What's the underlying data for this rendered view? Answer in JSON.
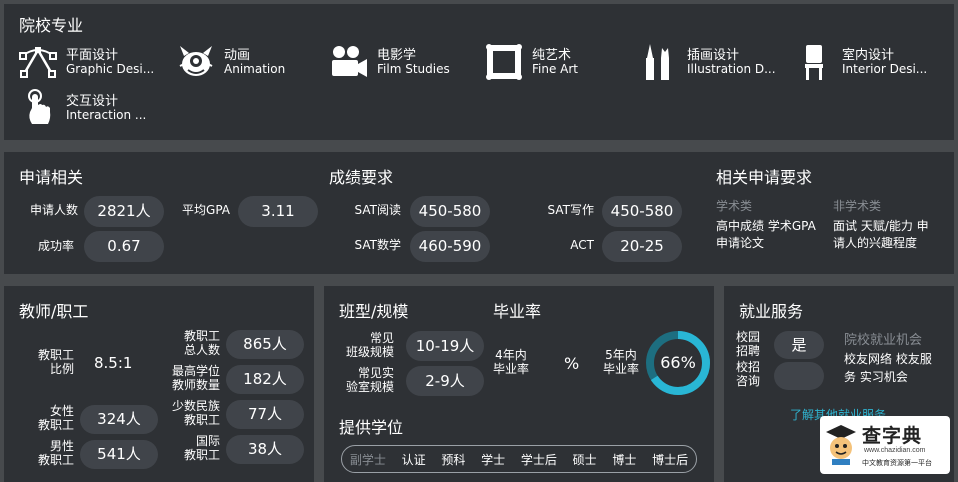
{
  "majors": {
    "title": "院校专业",
    "items": [
      {
        "zh": "平面设计",
        "en": "Graphic Desi...",
        "icon": "pen-tool-icon"
      },
      {
        "zh": "动画",
        "en": "Animation",
        "icon": "creature-icon"
      },
      {
        "zh": "电影学",
        "en": "Film Studies",
        "icon": "film-camera-icon"
      },
      {
        "zh": "纯艺术",
        "en": "Fine Art",
        "icon": "picture-frame-icon"
      },
      {
        "zh": "插画设计",
        "en": "Illustration D...",
        "icon": "brushes-icon"
      },
      {
        "zh": "室内设计",
        "en": "Interior Desi...",
        "icon": "chair-icon"
      },
      {
        "zh": "交互设计",
        "en": "Interaction ...",
        "icon": "touch-hand-icon"
      }
    ]
  },
  "application": {
    "title": "申请相关",
    "applicants_label": "申请人数",
    "applicants_value": "2821人",
    "gpa_label": "平均GPA",
    "gpa_value": "3.11",
    "success_label": "成功率",
    "success_value": "0.67"
  },
  "scores": {
    "title": "成绩要求",
    "sat_reading_label": "SAT阅读",
    "sat_reading_value": "450-580",
    "sat_writing_label": "SAT写作",
    "sat_writing_value": "450-580",
    "sat_math_label": "SAT数学",
    "sat_math_value": "460-590",
    "act_label": "ACT",
    "act_value": "20-25"
  },
  "requirements": {
    "title": "相关申请要求",
    "academic_title": "学术类",
    "academic_line1": "高中成绩 学术GPA",
    "academic_line2": "申请论文",
    "nonacademic_title": "非学术类",
    "nonacademic_line1": "面试 天赋/能力 申",
    "nonacademic_line2": "请人的兴趣程度"
  },
  "faculty": {
    "title": "教师/职工",
    "ratio_label_1": "教职工",
    "ratio_label_2": "比例",
    "ratio_value": "8.5:1",
    "total_label_1": "教职工",
    "total_label_2": "总人数",
    "total_value": "865人",
    "highest_label_1": "最高学位",
    "highest_label_2": "教师数量",
    "highest_value": "182人",
    "female_label_1": "女性",
    "female_label_2": "教职工",
    "female_value": "324人",
    "minority_label_1": "少数民族",
    "minority_label_2": "教职工",
    "minority_value": "77人",
    "male_label_1": "男性",
    "male_label_2": "教职工",
    "male_value": "541人",
    "intl_label_1": "国际",
    "intl_label_2": "教职工",
    "intl_value": "38人"
  },
  "classes": {
    "title": "班型/规模",
    "class_label_1": "常见",
    "class_label_2": "班级规模",
    "class_value": "10-19人",
    "lab_label_1": "常见实",
    "lab_label_2": "验室规模",
    "lab_value": "2-9人"
  },
  "graduation": {
    "title": "毕业率",
    "four_label_1": "4年内",
    "four_label_2": "毕业率",
    "four_value": "%",
    "five_label_1": "5年内",
    "five_label_2": "毕业率",
    "five_value": "66%",
    "five_fraction": 0.66,
    "ring_color": "#29b6d5"
  },
  "degrees": {
    "title": "提供学位",
    "items": [
      "副学士",
      "认证",
      "预科",
      "学士",
      "学士后",
      "硕士",
      "博士",
      "博士后"
    ]
  },
  "employment": {
    "title": "就业服务",
    "recruit_label_1": "校园",
    "recruit_label_2": "招聘",
    "recruit_value": "是",
    "consult_label_1": "校招",
    "consult_label_2": "咨询",
    "consult_value": "",
    "opp_title": "院校就业机会",
    "opp_line1": "校友网络 校友服",
    "opp_line2": "务 实习机会",
    "more_link": "了解其他就业服务"
  },
  "watermark": {
    "brand": "查字典",
    "url": "www.chazidian.com",
    "slogan": "中文教育资源第一平台"
  }
}
